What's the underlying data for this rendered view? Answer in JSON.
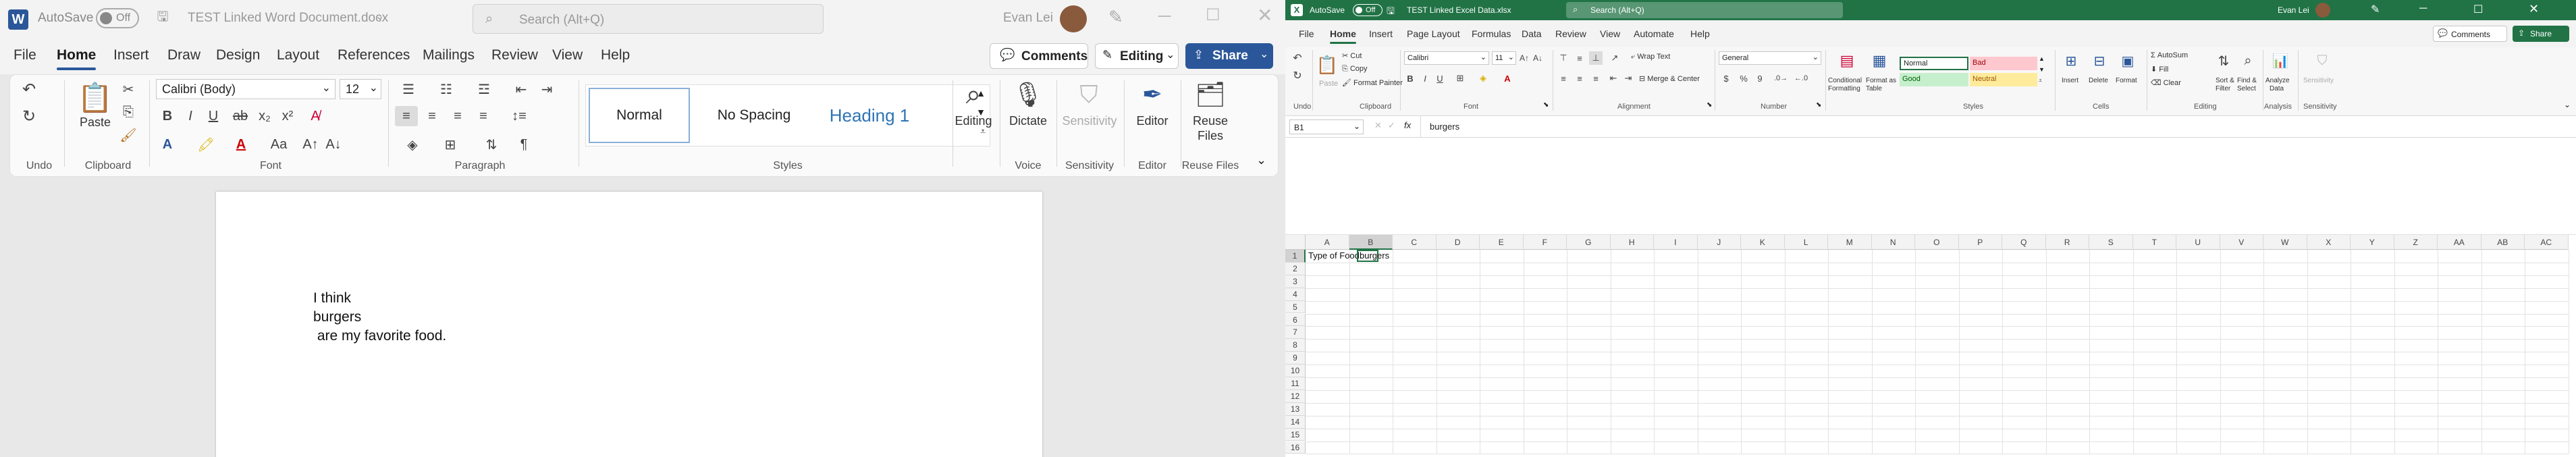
{
  "word": {
    "autosave_label": "AutoSave",
    "autosave_state": "Off",
    "doc_title": "TEST Linked Word Document.docx",
    "search_placeholder": "Search (Alt+Q)",
    "user_name": "Evan Lei",
    "tabs": [
      "File",
      "Home",
      "Insert",
      "Draw",
      "Design",
      "Layout",
      "References",
      "Mailings",
      "Review",
      "View",
      "Help"
    ],
    "comments_label": "Comments",
    "editing_label": "Editing",
    "share_label": "Share",
    "font_name": "Calibri (Body)",
    "font_size": "12",
    "styles": [
      "Normal",
      "No Spacing",
      "Heading 1"
    ],
    "groups": {
      "undo": "Undo",
      "clipboard": "Clipboard",
      "font": "Font",
      "paragraph": "Paragraph",
      "styles": "Styles",
      "voice": "Voice",
      "sensitivity": "Sensitivity",
      "editor": "Editor",
      "reuse": "Reuse Files"
    },
    "buttons": {
      "paste": "Paste",
      "editing": "Editing",
      "dictate": "Dictate",
      "sensitivity": "Sensitivity",
      "editor": "Editor",
      "reuse_line1": "Reuse",
      "reuse_line2": "Files"
    },
    "doc_lines": [
      "I think",
      "burgers",
      " are my favorite food."
    ]
  },
  "excel": {
    "autosave_label": "AutoSave",
    "autosave_state": "Off",
    "doc_title": "TEST Linked Excel Data.xlsx",
    "search_placeholder": "Search (Alt+Q)",
    "user_name": "Evan Lei",
    "tabs": [
      "File",
      "Home",
      "Insert",
      "Page Layout",
      "Formulas",
      "Data",
      "Review",
      "View",
      "Automate",
      "Help"
    ],
    "comments_label": "Comments",
    "share_label": "Share",
    "font_name": "Calibri",
    "font_size": "11",
    "number_format": "General",
    "clipboard": {
      "paste": "Paste",
      "cut": "Cut",
      "copy": "Copy",
      "format_painter": "Format Painter"
    },
    "alignment": {
      "wrap": "Wrap Text",
      "merge": "Merge & Center"
    },
    "styles": {
      "normal": "Normal",
      "bad": "Bad",
      "good": "Good",
      "neutral": "Neutral"
    },
    "buttons": {
      "conditional_1": "Conditional",
      "conditional_2": "Formatting",
      "format_table_1": "Format as",
      "format_table_2": "Table",
      "insert": "Insert",
      "delete": "Delete",
      "format": "Format",
      "autosum": "AutoSum",
      "fill": "Fill",
      "clear": "Clear",
      "sort_1": "Sort &",
      "sort_2": "Filter",
      "find_1": "Find &",
      "find_2": "Select",
      "analyze_1": "Analyze",
      "analyze_2": "Data",
      "sensitivity": "Sensitivity"
    },
    "groups": {
      "undo": "Undo",
      "clipboard": "Clipboard",
      "font": "Font",
      "alignment": "Alignment",
      "number": "Number",
      "styles": "Styles",
      "cells": "Cells",
      "editing": "Editing",
      "analysis": "Analysis",
      "sensitivity": "Sensitivity"
    },
    "name_box": "B1",
    "fx": "fx",
    "formula_value": "burgers",
    "columns": [
      "A",
      "B",
      "C",
      "D",
      "E",
      "F",
      "G",
      "H",
      "I",
      "J",
      "K",
      "L",
      "M",
      "N",
      "O",
      "P",
      "Q",
      "R",
      "S",
      "T",
      "U",
      "V",
      "W",
      "X",
      "Y",
      "Z",
      "AA",
      "AB",
      "AC"
    ],
    "rows": [
      "1",
      "2",
      "3",
      "4",
      "5",
      "6",
      "7",
      "8",
      "9",
      "10",
      "11",
      "12",
      "13",
      "14",
      "15",
      "16"
    ],
    "cells": {
      "A1": "Type of Food:",
      "B1": "burgers"
    },
    "colors": {
      "excel_green": "#217346",
      "word_blue": "#2b579a",
      "bad_fill": "#ffc7ce",
      "good_fill": "#c6efce",
      "neutral_fill": "#ffeb9c"
    }
  }
}
